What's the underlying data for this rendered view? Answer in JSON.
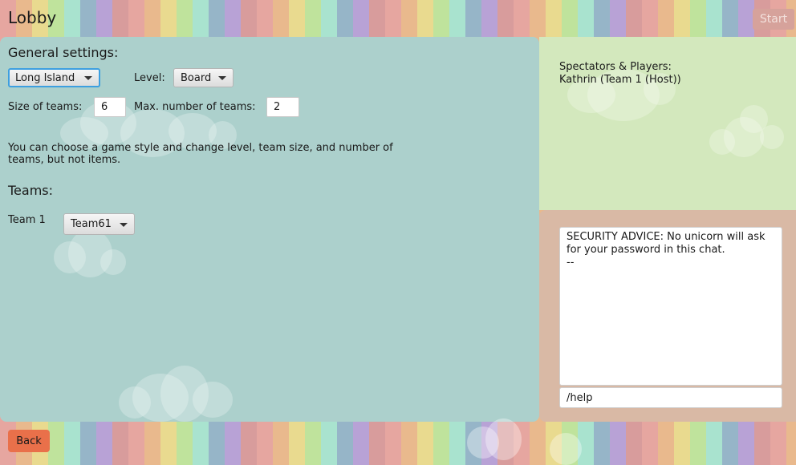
{
  "header": {
    "title": "Lobby",
    "start_label": "Start"
  },
  "general_settings": {
    "heading": "General settings:",
    "game_style": "Long Island",
    "level_label": "Level:",
    "level_value": "Board",
    "team_size_label": "Size of teams:",
    "team_size_value": "6",
    "max_teams_label": "Max. number of teams:",
    "max_teams_value": "2",
    "description": "You can choose a game style and change level, team size, and number of teams, but not items."
  },
  "teams": {
    "heading": "Teams:",
    "items": [
      {
        "label": "Team 1",
        "value": "Team61"
      }
    ]
  },
  "players": {
    "title": "Spectators & Players:",
    "entries": [
      "Kathrin (Team 1 (Host))"
    ]
  },
  "chat": {
    "lines": [
      "SECURITY ADVICE: No unicorn will ask for your password in this chat.",
      "--"
    ],
    "input_value": "/help"
  },
  "footer": {
    "back_label": "Back"
  },
  "colors": {
    "main_panel": "#acd0cc",
    "players_panel": "#d3e8bd",
    "chat_panel": "#d9b9a5",
    "back_button": "#e9704a",
    "focus_border": "#3d9fe0"
  }
}
